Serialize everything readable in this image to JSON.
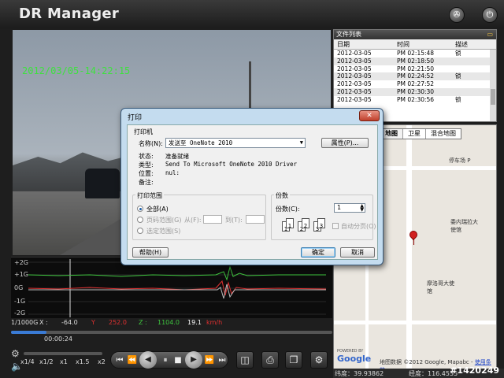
{
  "app": {
    "title": "DR Manager",
    "settings_icon": "film-reel-icon",
    "minimize_icon": "power-icon",
    "close_icon": "close-icon"
  },
  "video": {
    "timestamp": "2012/03/05-14:22:15"
  },
  "graph": {
    "y_labels": [
      "+2G",
      "+1G",
      "0G",
      "-1G",
      "-2G"
    ]
  },
  "readout": {
    "scale": "1/1000G",
    "x_label": "X :",
    "x_value": "-64.0",
    "y_label": "Y",
    "y_value": "252.0",
    "z_label": "Z :",
    "z_value": "1104.0",
    "speed": "19.1",
    "speed_unit": "km/h"
  },
  "timeline": {
    "time": "00:00:24",
    "progress": 0.11
  },
  "speed_control": {
    "labels": [
      "x1/4",
      "x1/2",
      "x1",
      "x1.5",
      "x2"
    ]
  },
  "file_list": {
    "header": "文件列表",
    "columns": [
      "日期",
      "时间",
      "描述"
    ],
    "rows": [
      {
        "date": "2012-03-05",
        "time": "PM 02:15:48",
        "desc": "锁"
      },
      {
        "date": "2012-03-05",
        "time": "PM 02:18:50",
        "desc": ""
      },
      {
        "date": "2012-03-05",
        "time": "PM 02:21:50",
        "desc": ""
      },
      {
        "date": "2012-03-05",
        "time": "PM 02:24:52",
        "desc": "锁"
      },
      {
        "date": "2012-03-05",
        "time": "PM 02:27:52",
        "desc": ""
      },
      {
        "date": "2012-03-05",
        "time": "PM 02:30:30",
        "desc": ""
      },
      {
        "date": "2012-03-05",
        "time": "PM 02:30:56",
        "desc": "锁"
      }
    ]
  },
  "map": {
    "tabs": [
      "地图",
      "卫星",
      "混合地图"
    ],
    "labels": {
      "parking": "停车场 P",
      "embassy1": "委内瑞拉大使馆",
      "embassy2": "摩洛哥大使馆"
    },
    "google": "Google",
    "powered": "POWERED BY",
    "copyright": "地图数据 ©2012 Google, Mapabc -",
    "terms": "使用条款"
  },
  "coords": {
    "lat": "纬度：39.93862",
    "lon": "经度：116.4555",
    "tag": "#1420249"
  },
  "dialog": {
    "title": "打印",
    "printer_group": "打印机",
    "name_label": "名称(N):",
    "printer_selected": "发送至 OneNote 2010",
    "properties_button": "属性(P)...",
    "status_label": "状态:",
    "status_value": "准备就绪",
    "type_label": "类型:",
    "type_value": "Send To Microsoft OneNote 2010 Driver",
    "where_label": "位置:",
    "where_value": "nul:",
    "comment_label": "备注:",
    "range_group": "打印范围",
    "range_all": "全部(A)",
    "range_pages": "页码范围(G)",
    "range_from": "从(F):",
    "range_to": "到(T):",
    "range_selection": "选定范围(S)",
    "copies_group": "份数",
    "copies_label": "份数(C):",
    "copies_value": "1",
    "collate_label": "自动分页(O)",
    "help_button": "帮助(H)",
    "ok_button": "确定",
    "cancel_button": "取消"
  }
}
